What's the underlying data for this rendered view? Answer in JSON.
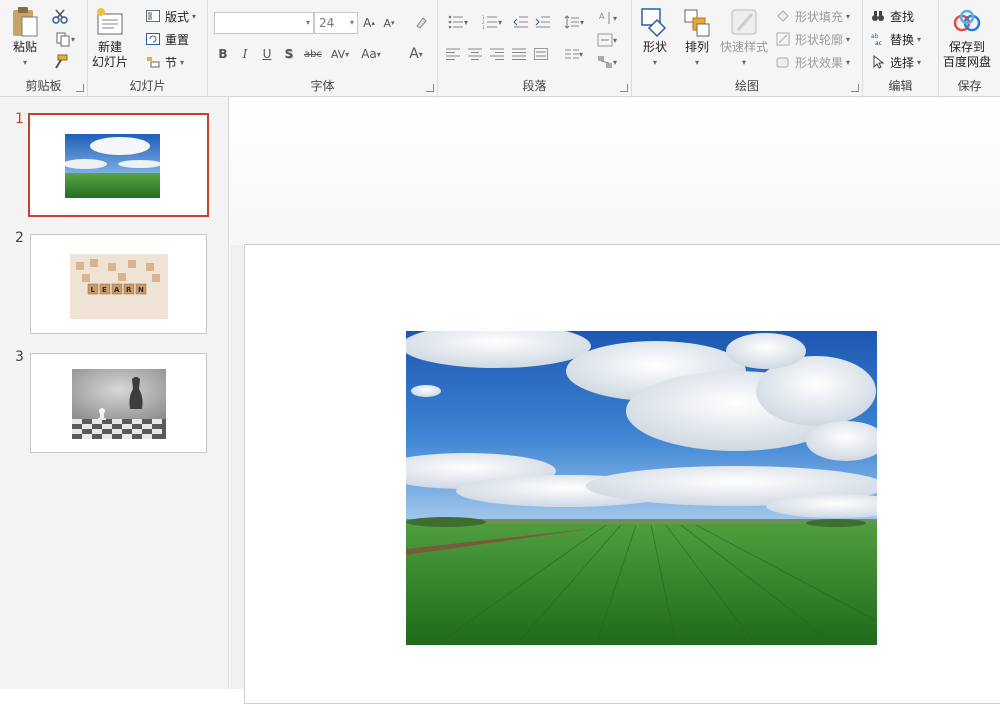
{
  "ribbon": {
    "clipboard": {
      "label": "剪贴板",
      "paste": "粘贴"
    },
    "slides": {
      "label": "幻灯片",
      "new_slide_line1": "新建",
      "new_slide_line2": "幻灯片",
      "layout": "版式",
      "reset": "重置",
      "section": "节"
    },
    "font": {
      "label": "字体",
      "font_name": "",
      "font_size": "24",
      "bold": "B",
      "italic": "I",
      "underline": "U",
      "shadow": "S",
      "strike": "abc",
      "spacing": "AV",
      "case": "Aa",
      "color": "A"
    },
    "paragraph": {
      "label": "段落"
    },
    "drawing": {
      "label": "绘图",
      "shape": "形状",
      "arrange": "排列",
      "quick_styles": "快速样式",
      "fill": "形状填充",
      "outline": "形状轮廓",
      "effects": "形状效果"
    },
    "editing": {
      "label": "编辑",
      "find": "查找",
      "replace": "替换",
      "select": "选择"
    },
    "save": {
      "label": "保存",
      "line1": "保存到",
      "line2": "百度网盘"
    }
  },
  "thumbnails": [
    {
      "number": "1",
      "active": true,
      "image": "sky-field"
    },
    {
      "number": "2",
      "active": false,
      "image": "learn-blocks"
    },
    {
      "number": "3",
      "active": false,
      "image": "chess-shadow"
    }
  ],
  "slide": {
    "image": "sky-field"
  },
  "colors": {
    "accent": "#c5432a",
    "sky": "#2d6fc4",
    "grass": "#3d8f2f"
  }
}
